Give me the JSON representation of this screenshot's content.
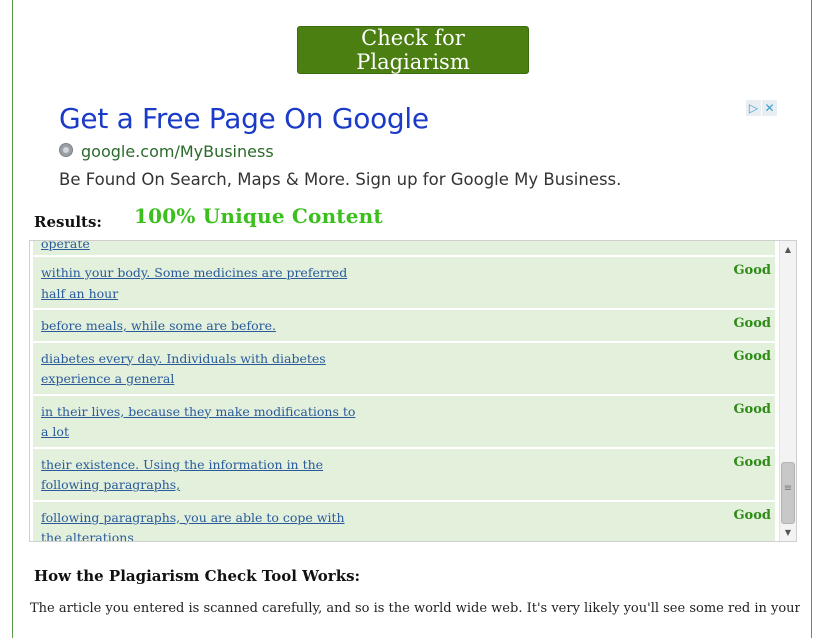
{
  "check_button": {
    "label": "Check for Plagiarism"
  },
  "ad": {
    "title": "Get a Free Page On Google",
    "url": "google.com/MyBusiness",
    "description": "Be Found On Search, Maps & More. Sign up for Google My Business.",
    "adchoices_play": "▷",
    "adchoices_close": "✕"
  },
  "results": {
    "label": "Results:",
    "summary": "100% Unique Content",
    "rows": [
      {
        "text": "operate",
        "status": ""
      },
      {
        "text": "within your body. Some medicines are preferred half an hour",
        "status": "Good"
      },
      {
        "text": "before meals, while some are before.",
        "status": "Good"
      },
      {
        "text": "diabetes every day. Individuals with diabetes experience a general",
        "status": "Good"
      },
      {
        "text": "in their lives, because they make modifications to a lot",
        "status": "Good"
      },
      {
        "text": "their existence. Using the information in the following paragraphs,",
        "status": "Good"
      },
      {
        "text": "following paragraphs, you are able to cope with the alterations",
        "status": "Good"
      }
    ]
  },
  "how": {
    "title": "How the Plagiarism Check Tool Works:",
    "text": "The article you entered is scanned carefully, and so is the world wide web. It's very likely you'll see some red in your results as"
  },
  "colors": {
    "button_bg": "#4b7f12",
    "unique_green": "#3bbf1c",
    "status_green": "#2f8a17",
    "row_bg": "#e2f0dc",
    "link_blue": "#2a5a9a",
    "ad_title_blue": "#1a3ac8"
  }
}
